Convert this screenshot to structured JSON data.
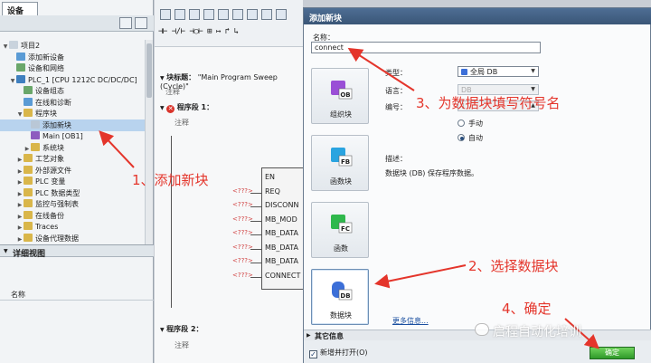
{
  "left_panel": {
    "tab": "设备",
    "tree": [
      {
        "label": "项目2",
        "level": 0,
        "arrow": "▼",
        "color": "#c9d3dd"
      },
      {
        "label": "添加新设备",
        "level": 1,
        "arrow": "",
        "color": "#5a9bd5"
      },
      {
        "label": "设备和网络",
        "level": 1,
        "arrow": "",
        "color": "#6aa76a"
      },
      {
        "label": "PLC_1 [CPU 1212C DC/DC/DC]",
        "level": 1,
        "arrow": "▼",
        "color": "#3f7fbf"
      },
      {
        "label": "设备组态",
        "level": 2,
        "arrow": "",
        "color": "#6aa76a"
      },
      {
        "label": "在线和诊断",
        "level": 2,
        "arrow": "",
        "color": "#5a9bd5"
      },
      {
        "label": "程序块",
        "level": 2,
        "arrow": "▼",
        "color": "#d9b64a"
      },
      {
        "label": "添加新块",
        "level": 3,
        "arrow": "",
        "color": "#b9c7d6",
        "selected": true
      },
      {
        "label": "Main [OB1]",
        "level": 3,
        "arrow": "",
        "color": "#8e5bbf"
      },
      {
        "label": "系统块",
        "level": 3,
        "arrow": "▶",
        "color": "#d9b64a"
      },
      {
        "label": "工艺对象",
        "level": 2,
        "arrow": "▶",
        "color": "#d9b64a"
      },
      {
        "label": "外部源文件",
        "level": 2,
        "arrow": "▶",
        "color": "#d9b64a"
      },
      {
        "label": "PLC 变量",
        "level": 2,
        "arrow": "▶",
        "color": "#d9b64a"
      },
      {
        "label": "PLC 数据类型",
        "level": 2,
        "arrow": "▶",
        "color": "#d9b64a"
      },
      {
        "label": "监控与强制表",
        "level": 2,
        "arrow": "▶",
        "color": "#d9b64a"
      },
      {
        "label": "在线备份",
        "level": 2,
        "arrow": "▶",
        "color": "#d9b64a"
      },
      {
        "label": "Traces",
        "level": 2,
        "arrow": "▶",
        "color": "#d9b64a"
      },
      {
        "label": "设备代理数据",
        "level": 2,
        "arrow": "▶",
        "color": "#d9b64a"
      }
    ],
    "detail_view": "详细视图",
    "detail_column": "名称"
  },
  "editor": {
    "ladder_symbols": "⊣⊢ ⊣/⊢ ⊣○⊢  ⊞  ↦  ↱  ↳",
    "block_title_label": "块标题：",
    "block_title_value": "\"Main Program Sweep (Cycle)\"",
    "comment": "注释",
    "network1": "程序段 1：",
    "network2": "程序段 2：",
    "pins": [
      "EN",
      "REQ",
      "DISCONN",
      "MB_MOD",
      "MB_DATA",
      "MB_DATA",
      "MB_DATA",
      "CONNECT"
    ],
    "pin_placeholder": "<???>"
  },
  "dialog": {
    "title": "添加新块",
    "name_label": "名称：",
    "name_value": "connect",
    "block_types": [
      {
        "code": "OB",
        "label": "组织块",
        "color": "#9a4fd6"
      },
      {
        "code": "FB",
        "label": "函数块",
        "color": "#2aa4e0"
      },
      {
        "code": "FC",
        "label": "函数",
        "color": "#2fb84c"
      },
      {
        "code": "DB",
        "label": "数据块",
        "color": "#3c6fd8",
        "selected": true
      }
    ],
    "type_label": "类型：",
    "type_value": "全局 DB",
    "language_label": "语言：",
    "language_value": "DB",
    "number_label": "编号：",
    "number_value": "1",
    "radio_manual": "手动",
    "radio_auto": "自动",
    "description_label": "描述：",
    "description_text": "数据块 (DB) 保存程序数据。",
    "more_info": "更多信息...",
    "info_bar": "其它信息",
    "add_and_open": "新增并打开(O)",
    "ok_button": "确定"
  },
  "annotations": {
    "step1": "1、添加新块",
    "step2": "2、选择数据块",
    "step3": "3、为数据块填写符号名",
    "step4": "4、确定",
    "watermark": "启程自动化培训",
    "color": "#e4352b"
  }
}
